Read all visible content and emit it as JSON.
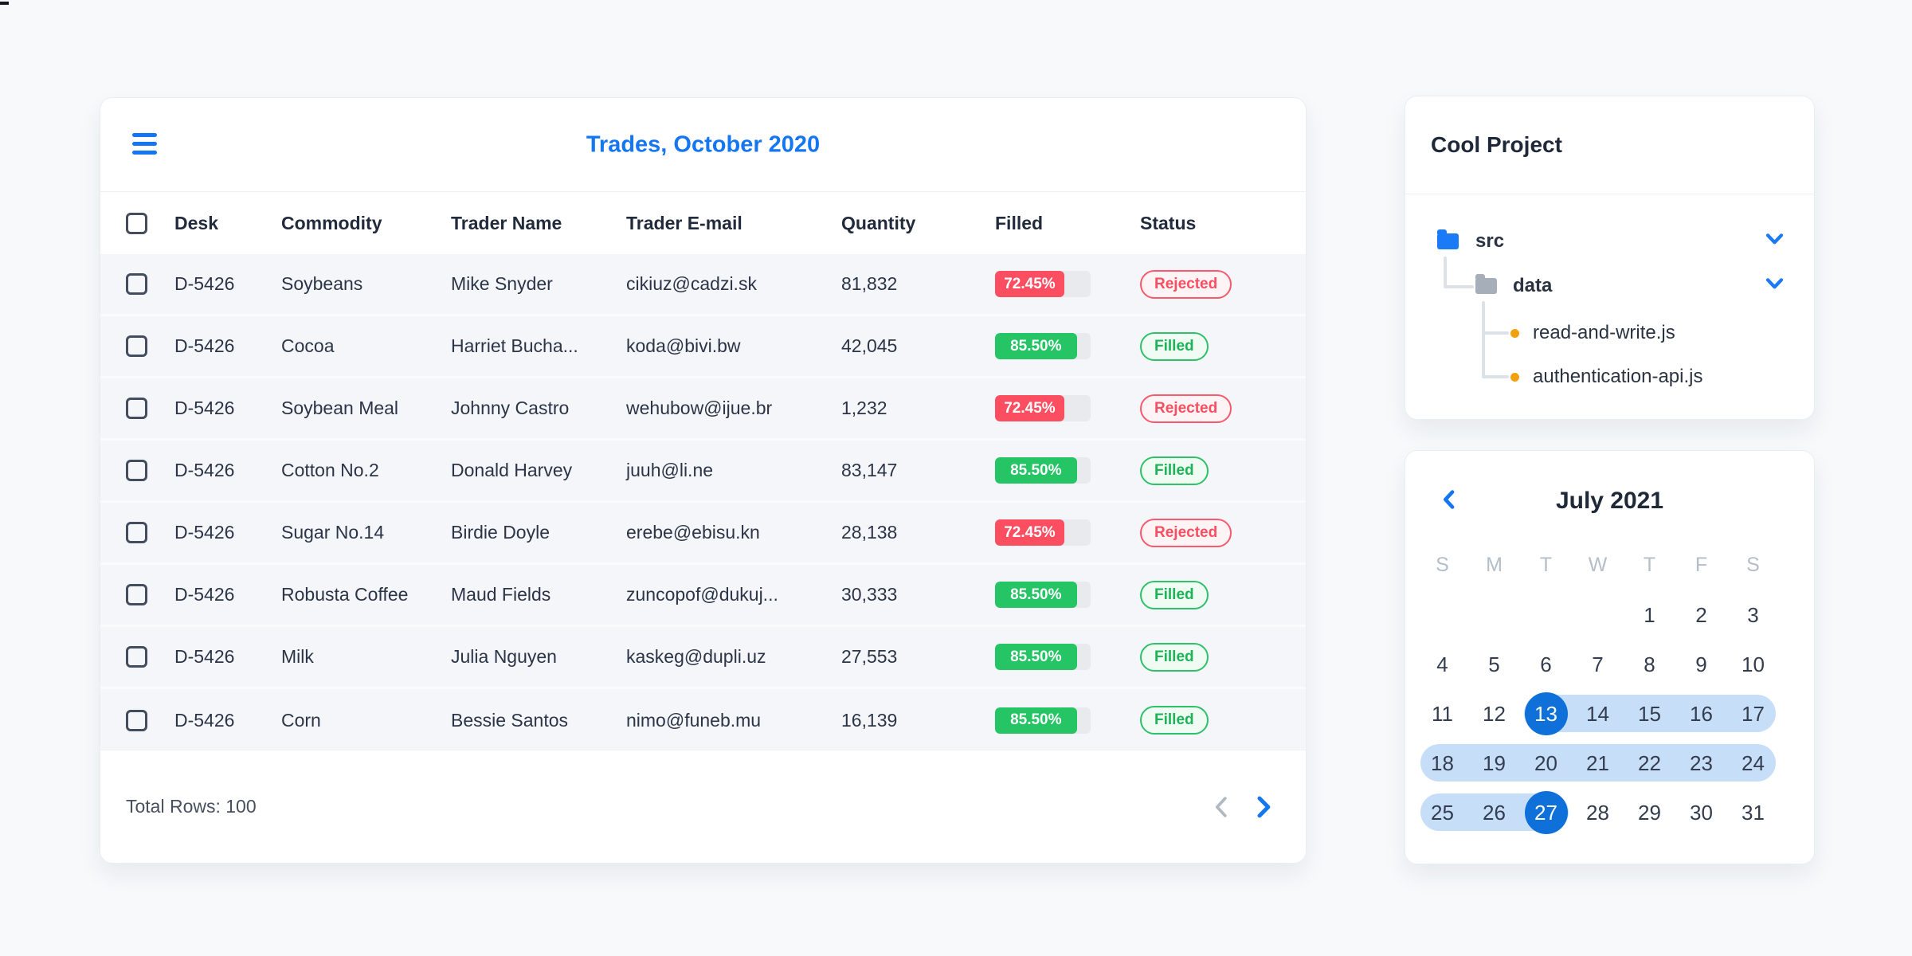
{
  "colors": {
    "accent": "#1476f2",
    "danger": "#fb4e61",
    "danger_soft": "#fef4f5",
    "success": "#25c464",
    "success_soft": "#f0fbf4",
    "track": "#e8eaee",
    "row_bg": "#f4f6f9",
    "band": "#c7def8",
    "selected_day": "#0e70d8",
    "folder_blue": "#1b7af5",
    "folder_gray": "#a6aeba",
    "file_dot": "#f3a00d",
    "connector": "#dde2e9",
    "muted": "#b4bec9"
  },
  "trades": {
    "title": "Trades, October 2020",
    "menu_icon": "hamburger-menu-icon",
    "columns": [
      "Desk",
      "Commodity",
      "Trader Name",
      "Trader E-mail",
      "Quantity",
      "Filled",
      "Status"
    ],
    "rows": [
      {
        "desk": "D-5426",
        "commodity": "Soybeans",
        "trader": "Mike Snyder",
        "email": "cikiuz@cadzi.sk",
        "quantity": "81,832",
        "filled_pct": "72.45%",
        "filled_value": 72.45,
        "status": "Rejected",
        "status_kind": "rejected"
      },
      {
        "desk": "D-5426",
        "commodity": "Cocoa",
        "trader": "Harriet Bucha...",
        "email": "koda@bivi.bw",
        "quantity": "42,045",
        "filled_pct": "85.50%",
        "filled_value": 85.5,
        "status": "Filled",
        "status_kind": "filled"
      },
      {
        "desk": "D-5426",
        "commodity": "Soybean Meal",
        "trader": "Johnny Castro",
        "email": "wehubow@ijue.br",
        "quantity": "1,232",
        "filled_pct": "72.45%",
        "filled_value": 72.45,
        "status": "Rejected",
        "status_kind": "rejected"
      },
      {
        "desk": "D-5426",
        "commodity": "Cotton No.2",
        "trader": "Donald Harvey",
        "email": "juuh@li.ne",
        "quantity": "83,147",
        "filled_pct": "85.50%",
        "filled_value": 85.5,
        "status": "Filled",
        "status_kind": "filled"
      },
      {
        "desk": "D-5426",
        "commodity": "Sugar No.14",
        "trader": "Birdie Doyle",
        "email": "erebe@ebisu.kn",
        "quantity": "28,138",
        "filled_pct": "72.45%",
        "filled_value": 72.45,
        "status": "Rejected",
        "status_kind": "rejected"
      },
      {
        "desk": "D-5426",
        "commodity": "Robusta Coffee",
        "trader": "Maud Fields",
        "email": "zuncopof@dukuj...",
        "quantity": "30,333",
        "filled_pct": "85.50%",
        "filled_value": 85.5,
        "status": "Filled",
        "status_kind": "filled"
      },
      {
        "desk": "D-5426",
        "commodity": "Milk",
        "trader": "Julia Nguyen",
        "email": "kaskeg@dupli.uz",
        "quantity": "27,553",
        "filled_pct": "85.50%",
        "filled_value": 85.5,
        "status": "Filled",
        "status_kind": "filled"
      },
      {
        "desk": "D-5426",
        "commodity": "Corn",
        "trader": "Bessie Santos",
        "email": "nimo@funeb.mu",
        "quantity": "16,139",
        "filled_pct": "85.50%",
        "filled_value": 85.5,
        "status": "Filled",
        "status_kind": "filled"
      }
    ],
    "footer": {
      "total_label": "Total Rows: 100",
      "prev_icon": "chevron-left",
      "next_icon": "chevron-right"
    }
  },
  "project": {
    "title": "Cool Project",
    "tree": [
      {
        "label": "src",
        "type": "folder",
        "folder_color": "blue",
        "level": 0,
        "expanded": true,
        "chevron_icon": "chevron-down"
      },
      {
        "label": "data",
        "type": "folder",
        "folder_color": "gray",
        "level": 1,
        "expanded": true,
        "chevron_icon": "chevron-down"
      },
      {
        "label": "read-and-write.js",
        "type": "file",
        "level": 2
      },
      {
        "label": "authentication-api.js",
        "type": "file",
        "level": 2
      }
    ]
  },
  "calendar": {
    "title": "July 2021",
    "prev_icon": "chevron-left",
    "weekdays": [
      "S",
      "M",
      "T",
      "W",
      "T",
      "F",
      "S"
    ],
    "weeks": [
      [
        "",
        "",
        "",
        "",
        "1",
        "2",
        "3"
      ],
      [
        "4",
        "5",
        "6",
        "7",
        "8",
        "9",
        "10"
      ],
      [
        "11",
        "12",
        "13",
        "14",
        "15",
        "16",
        "17"
      ],
      [
        "18",
        "19",
        "20",
        "21",
        "22",
        "23",
        "24"
      ],
      [
        "25",
        "26",
        "27",
        "28",
        "29",
        "30",
        "31"
      ]
    ],
    "selected_start": "13",
    "selected_end": "27",
    "ranges": [
      {
        "week": 2,
        "from": 2,
        "to": 6
      },
      {
        "week": 3,
        "from": 0,
        "to": 6
      },
      {
        "week": 4,
        "from": 0,
        "to": 2
      }
    ]
  }
}
